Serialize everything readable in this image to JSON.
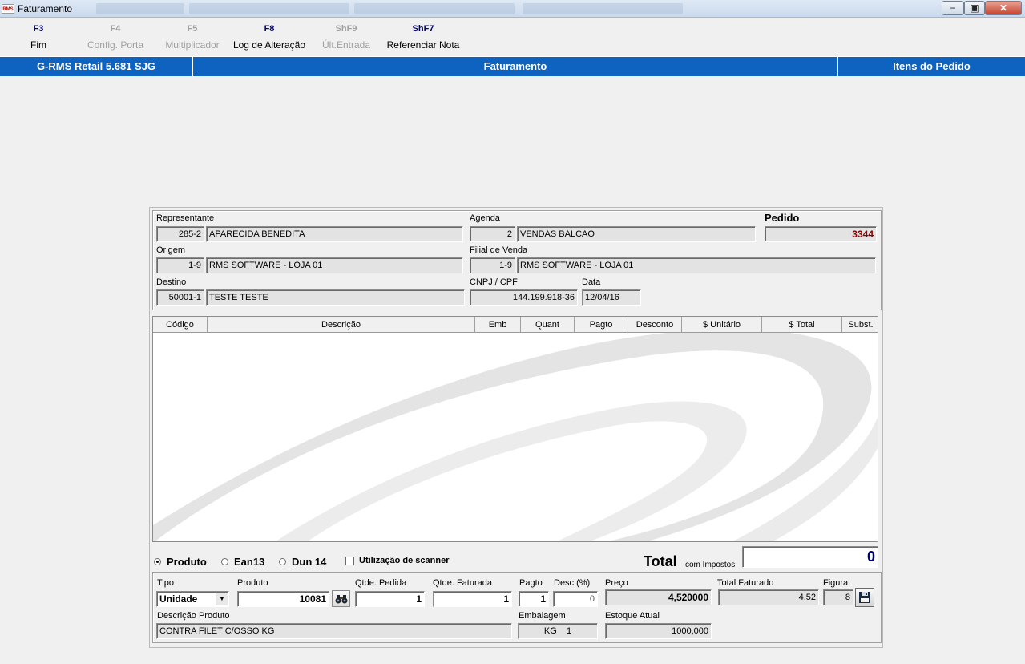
{
  "window": {
    "title": "Faturamento",
    "icon_text": "RMS",
    "min": "−",
    "max": "▣",
    "close": "✕"
  },
  "fkeys": [
    {
      "key": "F3",
      "label": "Fim"
    },
    {
      "key": "F4",
      "label": "Config. Porta"
    },
    {
      "key": "F5",
      "label": "Multiplicador"
    },
    {
      "key": "F8",
      "label": "Log de Alteração"
    },
    {
      "key": "ShF9",
      "label": "Últ.Entrada"
    },
    {
      "key": "ShF7",
      "label": "Referenciar Nota"
    }
  ],
  "bar": {
    "app": "G-RMS Retail 5.681 SJG",
    "module": "Faturamento",
    "section": "Itens do Pedido"
  },
  "header": {
    "representante": {
      "label": "Representante",
      "code": "285-2",
      "name": "APARECIDA BENEDITA"
    },
    "agenda": {
      "label": "Agenda",
      "code": "2",
      "name": "VENDAS BALCAO"
    },
    "pedido": {
      "label": "Pedido",
      "value": "3344"
    },
    "origem": {
      "label": "Origem",
      "code": "1-9",
      "name": "RMS SOFTWARE - LOJA 01"
    },
    "filial": {
      "label": "Filial de Venda",
      "code": "1-9",
      "name": "RMS SOFTWARE - LOJA 01"
    },
    "destino": {
      "label": "Destino",
      "code": "50001-1",
      "name": "TESTE TESTE"
    },
    "cnpj": {
      "label": "CNPJ / CPF",
      "value": "144.199.918-36"
    },
    "data": {
      "label": "Data",
      "value": "12/04/16"
    }
  },
  "grid": {
    "columns": [
      "Código",
      "Descrição",
      "Emb",
      "Quant",
      "Pagto",
      "Desconto",
      "$ Unitário",
      "$ Total",
      "Subst."
    ]
  },
  "search_mode": {
    "options": [
      "Produto",
      "Ean13",
      "Dun 14"
    ],
    "selected": "Produto",
    "scanner_label": "Utilização de scanner"
  },
  "total": {
    "label": "Total",
    "sublabel": "com Impostos",
    "value": "0"
  },
  "item": {
    "tipo_label": "Tipo",
    "tipo_value": "Unidade",
    "produto_label": "Produto",
    "produto_value": "10081",
    "qtde_pedida_label": "Qtde. Pedida",
    "qtde_pedida_value": "1",
    "qtde_faturada_label": "Qtde. Faturada",
    "qtde_faturada_value": "1",
    "pagto_label": "Pagto",
    "pagto_value": "1",
    "desc_label": "Desc (%)",
    "desc_value": "0",
    "preco_label": "Preço",
    "preco_value": "4,520000",
    "total_faturado_label": "Total Faturado",
    "total_faturado_value": "4,52",
    "figura_label": "Figura",
    "figura_value": "8",
    "descricao_label": "Descrição Produto",
    "descricao_value": "CONTRA FILET C/OSSO KG",
    "embalagem_label": "Embalagem",
    "embalagem_value": "KG    1",
    "estoque_label": "Estoque Atual",
    "estoque_value": "1000,000"
  },
  "colors": {
    "accent": "#0e63c0",
    "pedido": "#8b0000",
    "total": "#00007f"
  }
}
